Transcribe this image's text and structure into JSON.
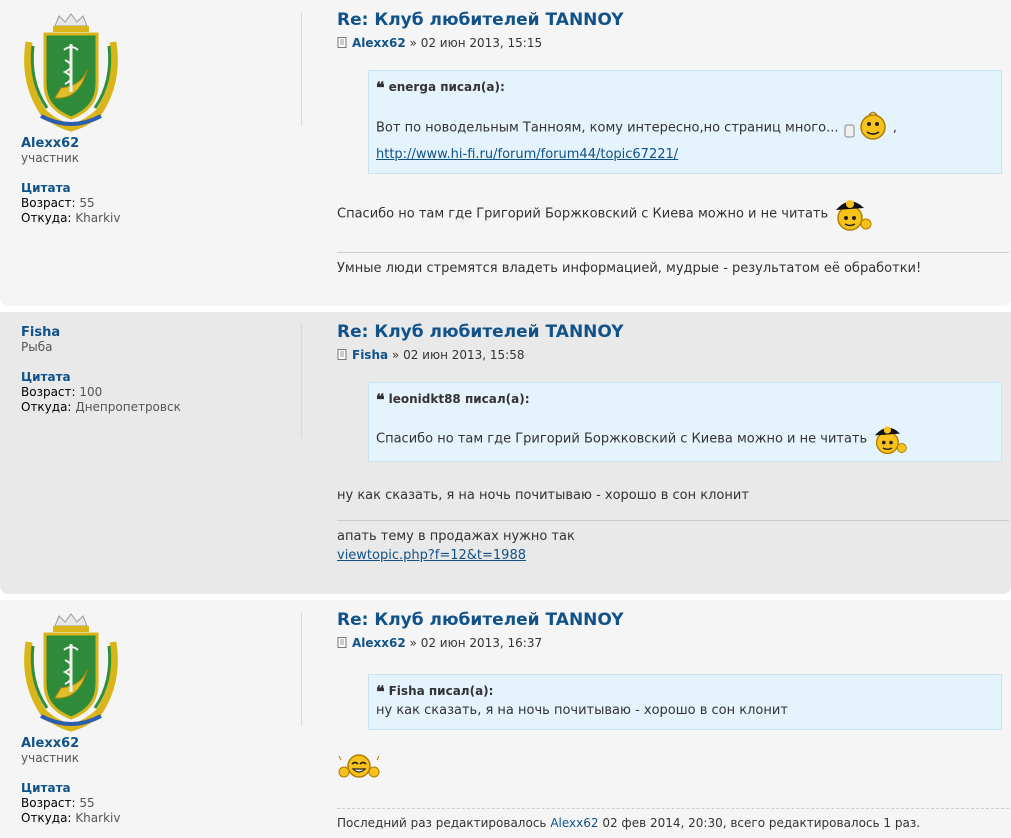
{
  "posts": [
    {
      "author": {
        "name": "Alexx62",
        "rank": "участник",
        "quote_label": "Цитата",
        "age_label": "Возраст:",
        "age": "55",
        "from_label": "Откуда:",
        "from": "Kharkiv",
        "has_avatar": true
      },
      "title": "Re: Клуб любителей TANNOY",
      "byline_sep": "»",
      "date": "02 июн 2013, 15:15",
      "quote": {
        "cite": "energa писал(а):",
        "text": "Вот по новодельным Танноям, кому интересно,но страниц много...",
        "comma": ",",
        "link": "http://www.hi-fi.ru/forum/forum44/topic67221/"
      },
      "content": "Спасибо но там где Григорий Боржковский с Киева можно и не читать",
      "signature": "Умные люди стремятся владеть информацией, мудрые - результатом её обработки!"
    },
    {
      "author": {
        "name": "Fisha",
        "rank": "Рыба",
        "quote_label": "Цитата",
        "age_label": "Возраст:",
        "age": "100",
        "from_label": "Откуда:",
        "from": "Днепропетровск",
        "has_avatar": false
      },
      "title": "Re: Клуб любителей TANNOY",
      "byline_sep": "»",
      "date": "02 июн 2013, 15:58",
      "quote": {
        "cite": "leonidkt88 писал(а):",
        "text": "Спасибо но там где Григорий Боржковский с Киева можно и не читать"
      },
      "content": "ну как сказать, я на ночь почитываю - хорошо в сон клонит",
      "signature": "апать тему в продажах нужно так",
      "signature_link": "viewtopic.php?f=12&t=1988"
    },
    {
      "author": {
        "name": "Alexx62",
        "rank": "участник",
        "quote_label": "Цитата",
        "age_label": "Возраст:",
        "age": "55",
        "from_label": "Откуда:",
        "from": "Kharkiv",
        "has_avatar": true
      },
      "title": "Re: Клуб любителей TANNOY",
      "byline_sep": "»",
      "date": "02 июн 2013, 16:37",
      "quote": {
        "cite": "Fisha писал(а):",
        "text": "ну как сказать, я на ночь почитываю - хорошо в сон клонит"
      },
      "edit_note": {
        "prefix": "Последний раз редактировалось",
        "who": "Alexx62",
        "suffix": "02 фев 2014, 20:30, всего редактировалось 1 раз."
      }
    }
  ],
  "colors": {
    "link": "#105289",
    "quote_bg": "#e4f3fc",
    "post_bg1": "#f5f5f5",
    "post_bg2": "#e9e9e9"
  },
  "icons": [
    "coat-of-arms-avatar",
    "post-icon",
    "quote-mark-icon",
    "smiley-thumbs-up",
    "smiley-cap-thinking",
    "smiley-clapping"
  ]
}
